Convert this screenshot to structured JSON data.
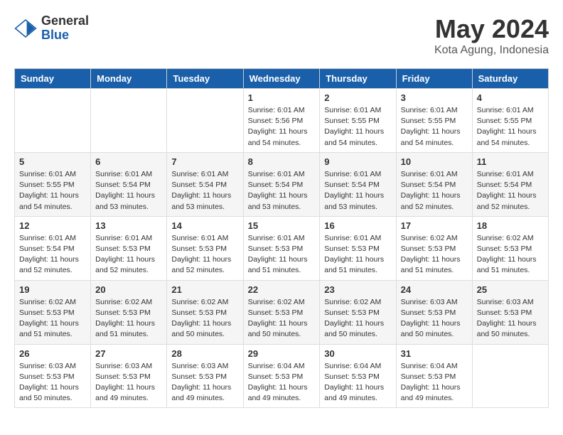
{
  "header": {
    "logo_general": "General",
    "logo_blue": "Blue",
    "month": "May 2024",
    "location": "Kota Agung, Indonesia"
  },
  "weekdays": [
    "Sunday",
    "Monday",
    "Tuesday",
    "Wednesday",
    "Thursday",
    "Friday",
    "Saturday"
  ],
  "weeks": [
    [
      {
        "day": "",
        "info": ""
      },
      {
        "day": "",
        "info": ""
      },
      {
        "day": "",
        "info": ""
      },
      {
        "day": "1",
        "info": "Sunrise: 6:01 AM\nSunset: 5:56 PM\nDaylight: 11 hours\nand 54 minutes."
      },
      {
        "day": "2",
        "info": "Sunrise: 6:01 AM\nSunset: 5:55 PM\nDaylight: 11 hours\nand 54 minutes."
      },
      {
        "day": "3",
        "info": "Sunrise: 6:01 AM\nSunset: 5:55 PM\nDaylight: 11 hours\nand 54 minutes."
      },
      {
        "day": "4",
        "info": "Sunrise: 6:01 AM\nSunset: 5:55 PM\nDaylight: 11 hours\nand 54 minutes."
      }
    ],
    [
      {
        "day": "5",
        "info": "Sunrise: 6:01 AM\nSunset: 5:55 PM\nDaylight: 11 hours\nand 54 minutes."
      },
      {
        "day": "6",
        "info": "Sunrise: 6:01 AM\nSunset: 5:54 PM\nDaylight: 11 hours\nand 53 minutes."
      },
      {
        "day": "7",
        "info": "Sunrise: 6:01 AM\nSunset: 5:54 PM\nDaylight: 11 hours\nand 53 minutes."
      },
      {
        "day": "8",
        "info": "Sunrise: 6:01 AM\nSunset: 5:54 PM\nDaylight: 11 hours\nand 53 minutes."
      },
      {
        "day": "9",
        "info": "Sunrise: 6:01 AM\nSunset: 5:54 PM\nDaylight: 11 hours\nand 53 minutes."
      },
      {
        "day": "10",
        "info": "Sunrise: 6:01 AM\nSunset: 5:54 PM\nDaylight: 11 hours\nand 52 minutes."
      },
      {
        "day": "11",
        "info": "Sunrise: 6:01 AM\nSunset: 5:54 PM\nDaylight: 11 hours\nand 52 minutes."
      }
    ],
    [
      {
        "day": "12",
        "info": "Sunrise: 6:01 AM\nSunset: 5:54 PM\nDaylight: 11 hours\nand 52 minutes."
      },
      {
        "day": "13",
        "info": "Sunrise: 6:01 AM\nSunset: 5:53 PM\nDaylight: 11 hours\nand 52 minutes."
      },
      {
        "day": "14",
        "info": "Sunrise: 6:01 AM\nSunset: 5:53 PM\nDaylight: 11 hours\nand 52 minutes."
      },
      {
        "day": "15",
        "info": "Sunrise: 6:01 AM\nSunset: 5:53 PM\nDaylight: 11 hours\nand 51 minutes."
      },
      {
        "day": "16",
        "info": "Sunrise: 6:01 AM\nSunset: 5:53 PM\nDaylight: 11 hours\nand 51 minutes."
      },
      {
        "day": "17",
        "info": "Sunrise: 6:02 AM\nSunset: 5:53 PM\nDaylight: 11 hours\nand 51 minutes."
      },
      {
        "day": "18",
        "info": "Sunrise: 6:02 AM\nSunset: 5:53 PM\nDaylight: 11 hours\nand 51 minutes."
      }
    ],
    [
      {
        "day": "19",
        "info": "Sunrise: 6:02 AM\nSunset: 5:53 PM\nDaylight: 11 hours\nand 51 minutes."
      },
      {
        "day": "20",
        "info": "Sunrise: 6:02 AM\nSunset: 5:53 PM\nDaylight: 11 hours\nand 51 minutes."
      },
      {
        "day": "21",
        "info": "Sunrise: 6:02 AM\nSunset: 5:53 PM\nDaylight: 11 hours\nand 50 minutes."
      },
      {
        "day": "22",
        "info": "Sunrise: 6:02 AM\nSunset: 5:53 PM\nDaylight: 11 hours\nand 50 minutes."
      },
      {
        "day": "23",
        "info": "Sunrise: 6:02 AM\nSunset: 5:53 PM\nDaylight: 11 hours\nand 50 minutes."
      },
      {
        "day": "24",
        "info": "Sunrise: 6:03 AM\nSunset: 5:53 PM\nDaylight: 11 hours\nand 50 minutes."
      },
      {
        "day": "25",
        "info": "Sunrise: 6:03 AM\nSunset: 5:53 PM\nDaylight: 11 hours\nand 50 minutes."
      }
    ],
    [
      {
        "day": "26",
        "info": "Sunrise: 6:03 AM\nSunset: 5:53 PM\nDaylight: 11 hours\nand 50 minutes."
      },
      {
        "day": "27",
        "info": "Sunrise: 6:03 AM\nSunset: 5:53 PM\nDaylight: 11 hours\nand 49 minutes."
      },
      {
        "day": "28",
        "info": "Sunrise: 6:03 AM\nSunset: 5:53 PM\nDaylight: 11 hours\nand 49 minutes."
      },
      {
        "day": "29",
        "info": "Sunrise: 6:04 AM\nSunset: 5:53 PM\nDaylight: 11 hours\nand 49 minutes."
      },
      {
        "day": "30",
        "info": "Sunrise: 6:04 AM\nSunset: 5:53 PM\nDaylight: 11 hours\nand 49 minutes."
      },
      {
        "day": "31",
        "info": "Sunrise: 6:04 AM\nSunset: 5:53 PM\nDaylight: 11 hours\nand 49 minutes."
      },
      {
        "day": "",
        "info": ""
      }
    ]
  ]
}
